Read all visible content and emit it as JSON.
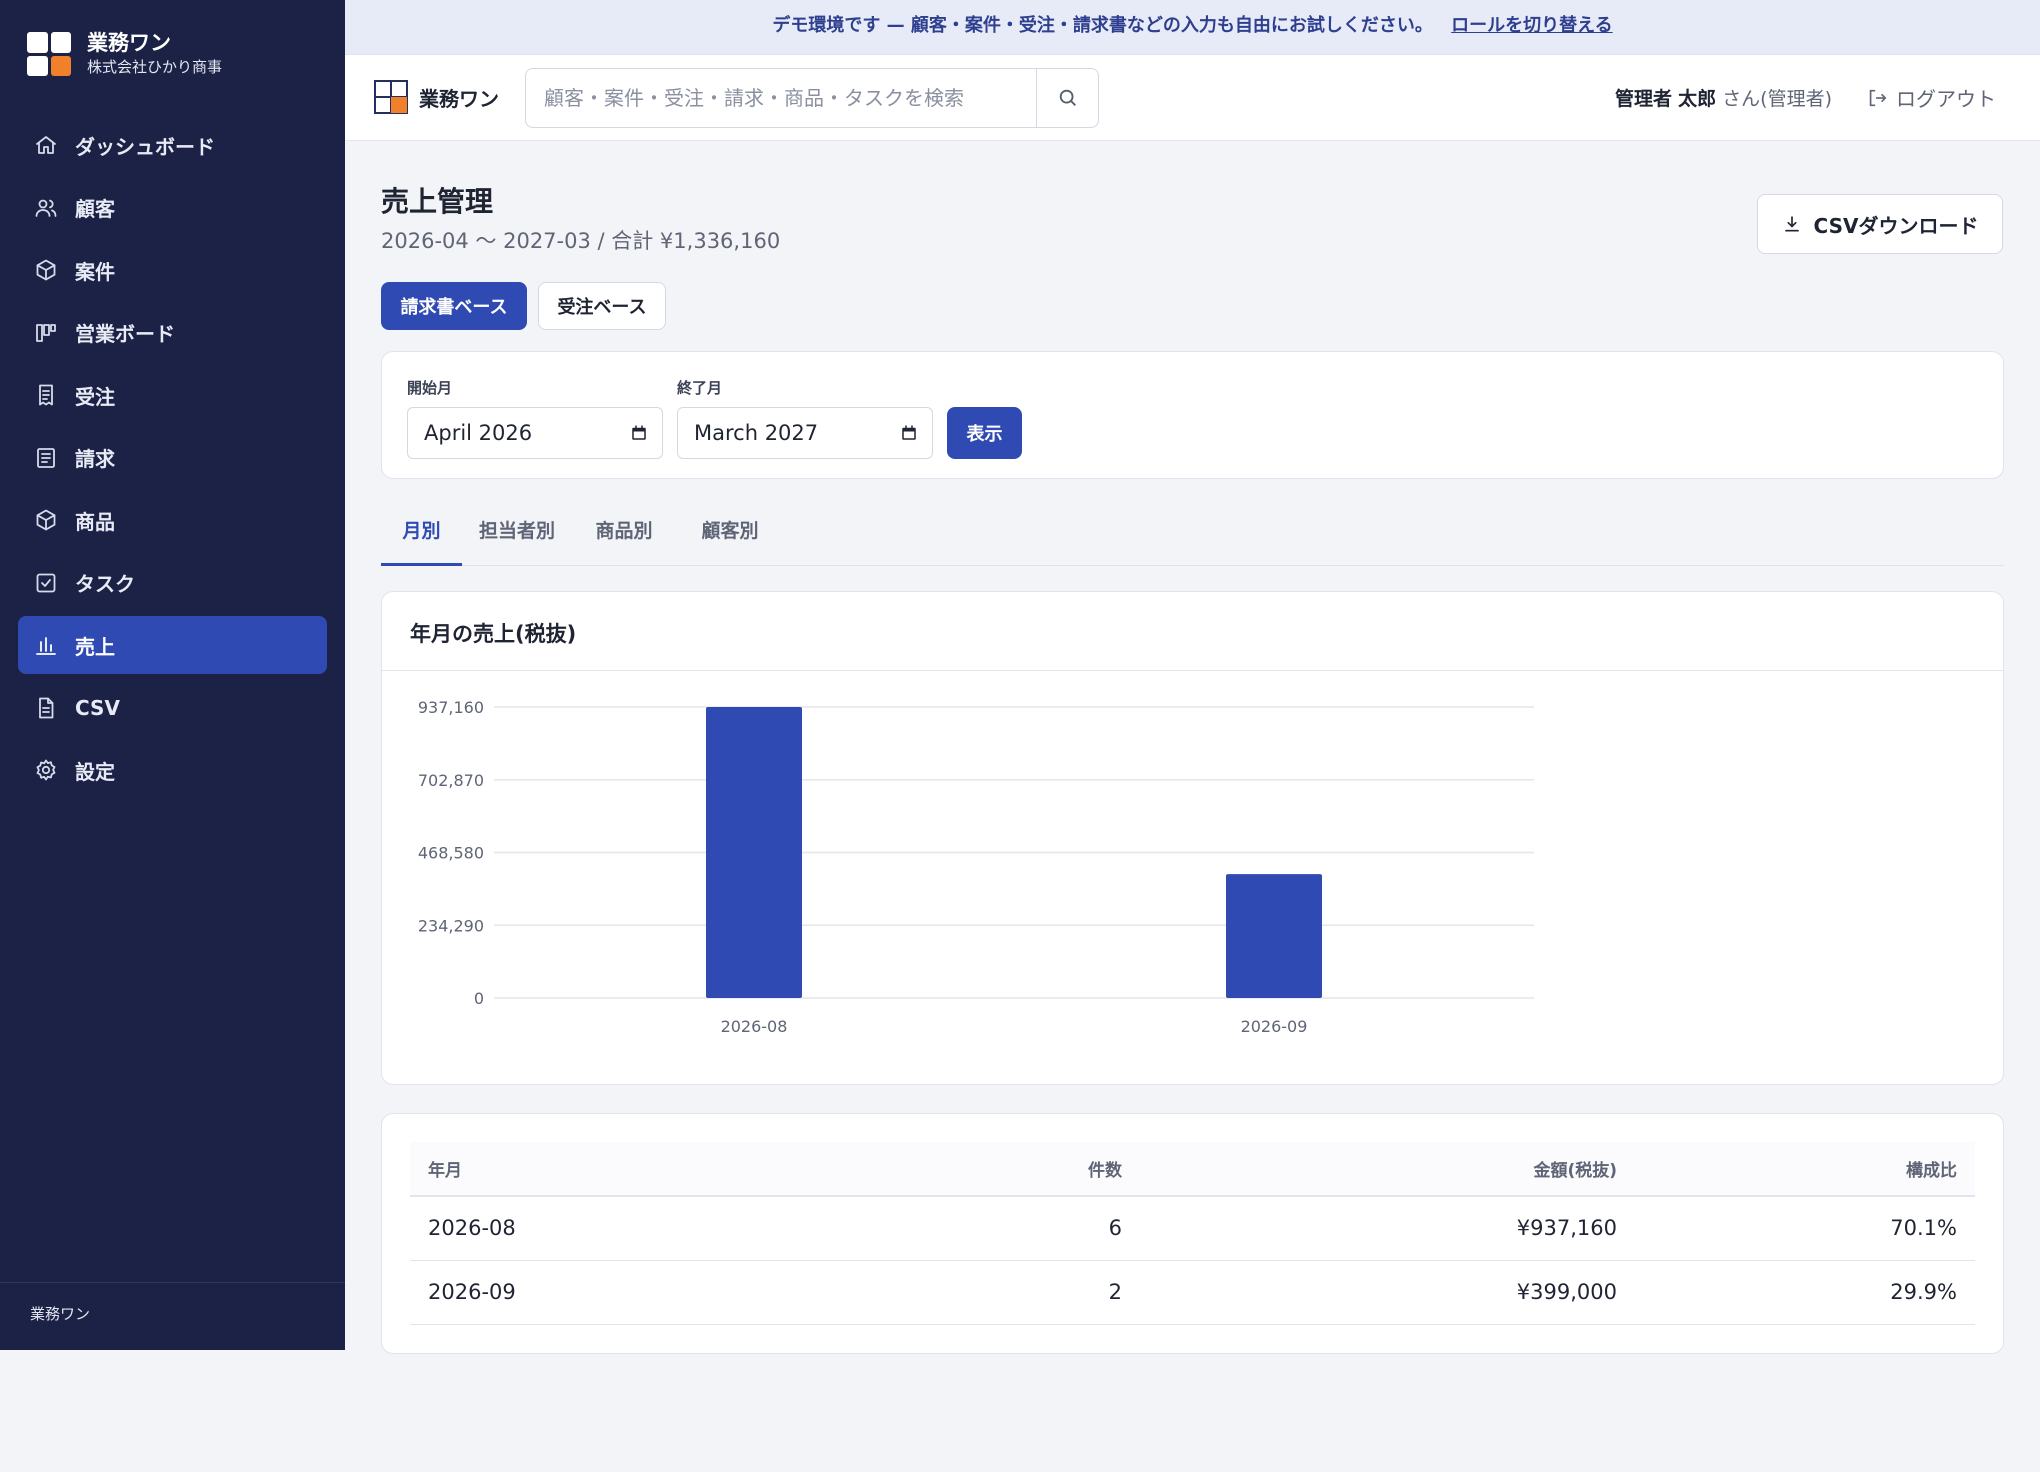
{
  "sidebar": {
    "brand_name": "業務ワン",
    "company": "株式会社ひかり商事",
    "items": [
      {
        "label": "ダッシュボード",
        "icon": "home-icon"
      },
      {
        "label": "顧客",
        "icon": "users-icon"
      },
      {
        "label": "案件",
        "icon": "box-icon"
      },
      {
        "label": "営業ボード",
        "icon": "kanban-icon"
      },
      {
        "label": "受注",
        "icon": "receipt-icon"
      },
      {
        "label": "請求",
        "icon": "document-icon"
      },
      {
        "label": "商品",
        "icon": "box-icon"
      },
      {
        "label": "タスク",
        "icon": "checkbox-icon"
      },
      {
        "label": "売上",
        "icon": "bar-chart-icon",
        "active": true
      },
      {
        "label": "CSV",
        "icon": "file-icon"
      },
      {
        "label": "設定",
        "icon": "gear-icon"
      }
    ],
    "footer": "業務ワン"
  },
  "banner": {
    "text": "デモ環境です — 顧客・案件・受注・請求書などの入力も自由にお試しください。",
    "link": "ロールを切り替える"
  },
  "topbar": {
    "brand_name": "業務ワン",
    "search_placeholder": "顧客・案件・受注・請求・商品・タスクを検索",
    "user_role": "管理者",
    "user_name": "太郎",
    "user_suffix": "さん(管理者)",
    "logout": "ログアウト"
  },
  "page": {
    "title": "売上管理",
    "subtitle": "2026-04 〜 2027-03 / 合計 ¥1,336,160",
    "csv_button": "CSVダウンロード",
    "base_toggle": {
      "active": "請求書ベース",
      "inactive": "受注ベース"
    },
    "filter": {
      "start_label": "開始月",
      "start_value": "April 2026",
      "end_label": "終了月",
      "end_value": "March 2027",
      "show_button": "表示"
    },
    "tabs": [
      "月別",
      "担当者別",
      "商品別",
      "顧客別"
    ],
    "active_tab": 0
  },
  "chart": {
    "title": "年月の売上(税抜)"
  },
  "chart_data": {
    "type": "bar",
    "title": "年月の売上(税抜)",
    "categories": [
      "2026-08",
      "2026-09"
    ],
    "values": [
      937160,
      399000
    ],
    "yticks": [
      0,
      234290,
      468580,
      702870,
      937160
    ],
    "ytick_labels": [
      "0",
      "234,290",
      "468,580",
      "702,870",
      "937,160"
    ],
    "ylim": [
      0,
      937160
    ],
    "grid": true,
    "color": "#2f4ab3"
  },
  "table": {
    "headers": [
      "年月",
      "件数",
      "金額(税抜)",
      "構成比"
    ],
    "rows": [
      [
        "2026-08",
        "6",
        "¥937,160",
        "70.1%"
      ],
      [
        "2026-09",
        "2",
        "¥399,000",
        "29.9%"
      ]
    ]
  },
  "colors": {
    "sidebar_bg": "#1b2246",
    "accent": "#2f4ab3",
    "brand_orange": "#f0802a",
    "banner_bg": "#e6ebf7"
  }
}
